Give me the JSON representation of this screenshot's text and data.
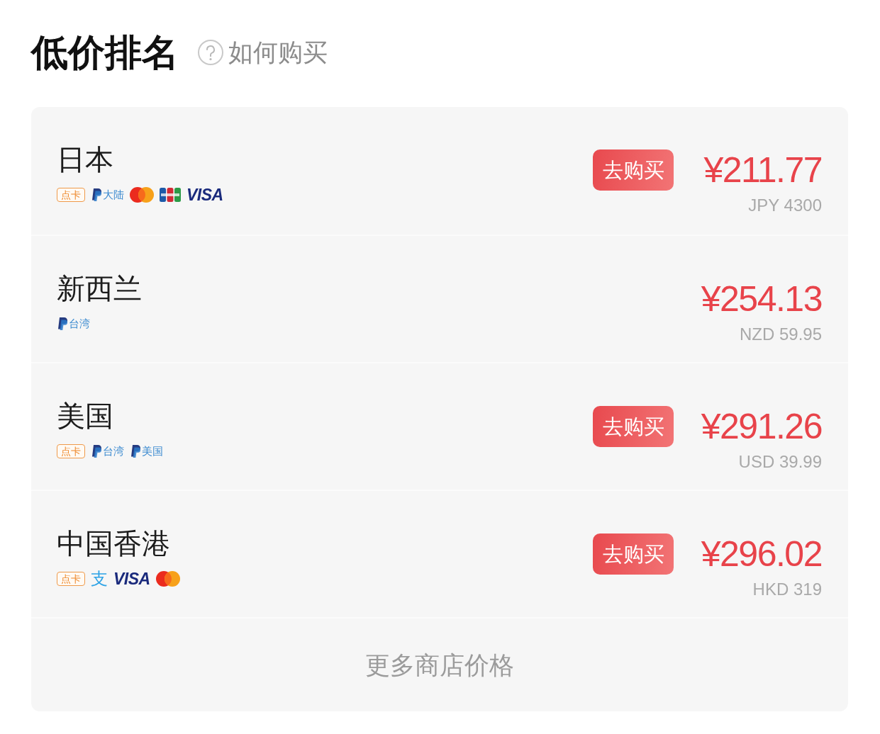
{
  "header": {
    "title": "低价排名",
    "help_link": "如何购买"
  },
  "stores": [
    {
      "region": "日本",
      "payments": [
        {
          "kind": "card",
          "label": "点卡"
        },
        {
          "kind": "paypal",
          "label": "大陆"
        },
        {
          "kind": "mastercard"
        },
        {
          "kind": "jcb"
        },
        {
          "kind": "visa",
          "label": "VISA"
        }
      ],
      "buy_label": "去购买",
      "price": "¥211.77",
      "local_price": "JPY 4300"
    },
    {
      "region": "新西兰",
      "payments": [
        {
          "kind": "paypal",
          "label": "台湾"
        }
      ],
      "price": "¥254.13",
      "local_price": "NZD 59.95"
    },
    {
      "region": "美国",
      "payments": [
        {
          "kind": "card",
          "label": "点卡"
        },
        {
          "kind": "paypal",
          "label": "台湾"
        },
        {
          "kind": "paypal",
          "label": "美国"
        }
      ],
      "buy_label": "去购买",
      "price": "¥291.26",
      "local_price": "USD 39.99"
    },
    {
      "region": "中国香港",
      "payments": [
        {
          "kind": "card",
          "label": "点卡"
        },
        {
          "kind": "alipay",
          "label": "支"
        },
        {
          "kind": "visa",
          "label": "VISA"
        },
        {
          "kind": "mastercard"
        }
      ],
      "buy_label": "去购买",
      "price": "¥296.02",
      "local_price": "HKD 319"
    }
  ],
  "more_link": "更多商店价格"
}
